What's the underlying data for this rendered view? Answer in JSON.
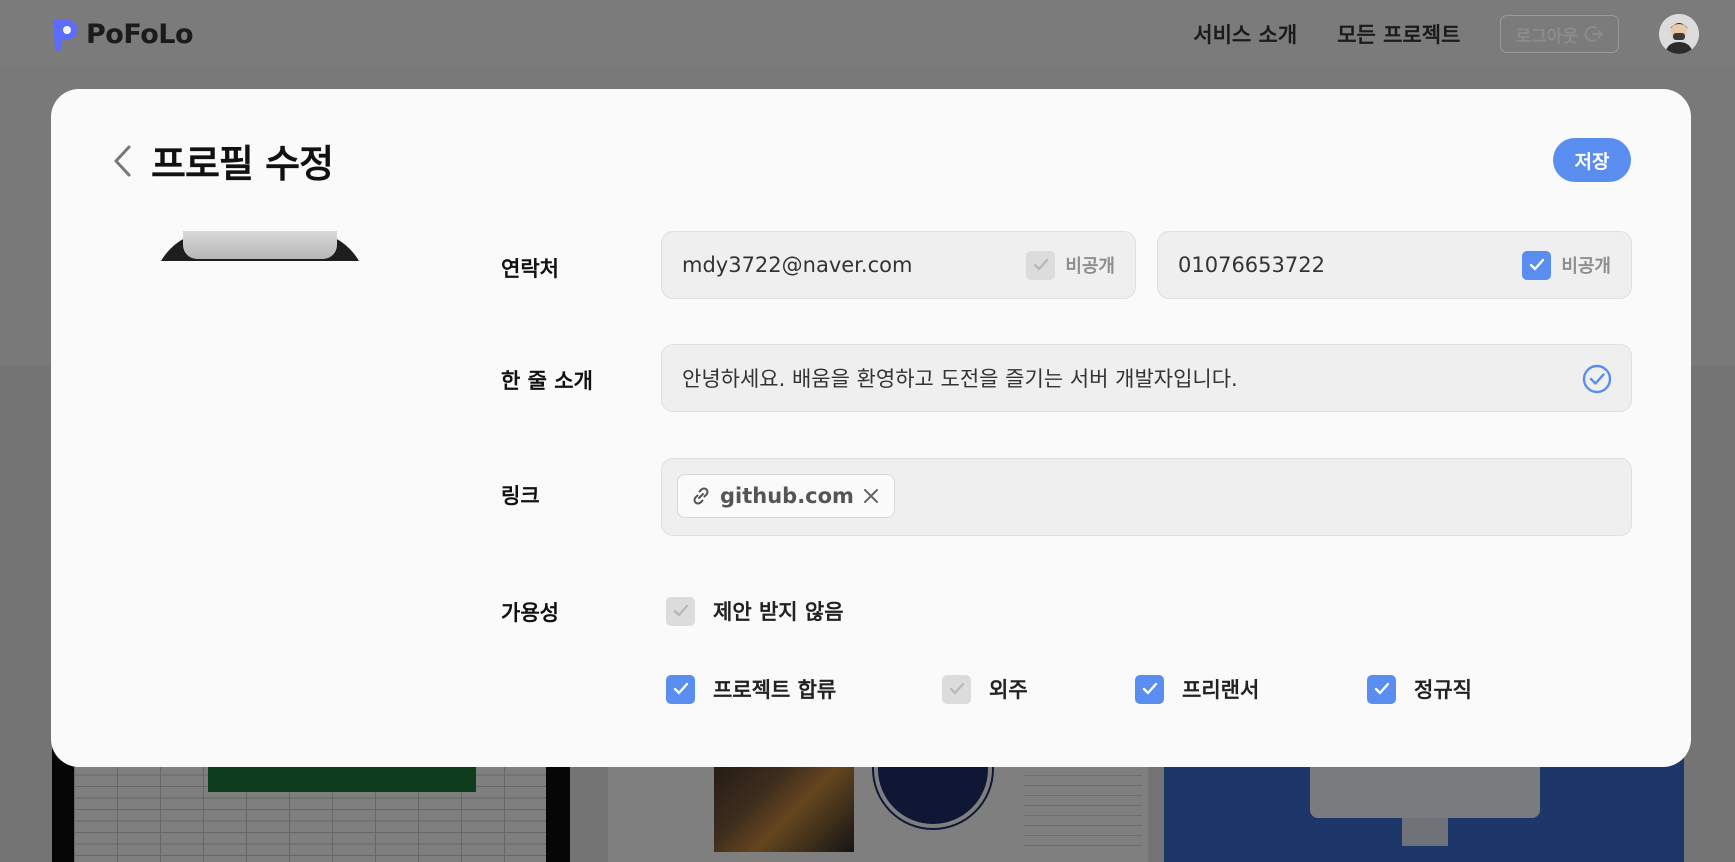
{
  "brand": {
    "name": "PoFoLo",
    "color": "#5b6cff"
  },
  "nav": {
    "links": [
      "서비스 소개",
      "모든 프로젝트"
    ],
    "logout_label": "로그아웃",
    "logout_icon": "logout-icon"
  },
  "modal": {
    "title": "프로필 수정",
    "back_icon": "chevron-left-icon",
    "save_label": "저장",
    "accent": "#5a8df0"
  },
  "contact": {
    "label": "연락처",
    "email": "mdy3722@naver.com",
    "email_private": false,
    "phone": "01076653722",
    "phone_private": true,
    "private_label": "비공개"
  },
  "intro": {
    "label": "한 줄 소개",
    "value": "안녕하세요. 배움을 환영하고 도전을 즐기는 서버 개발자입니다.",
    "status_icon": "check-circle-icon"
  },
  "links": {
    "label": "링크",
    "items": [
      {
        "text": "github.com",
        "icon": "link-icon",
        "remove_icon": "close-icon"
      }
    ]
  },
  "availability": {
    "label": "가용성",
    "no_offers": {
      "label": "제안 받지 않음",
      "checked": false
    },
    "options": [
      {
        "label": "프로젝트 합류",
        "checked": true
      },
      {
        "label": "외주",
        "checked": false
      },
      {
        "label": "프리랜서",
        "checked": true
      },
      {
        "label": "정규직",
        "checked": true
      }
    ]
  }
}
